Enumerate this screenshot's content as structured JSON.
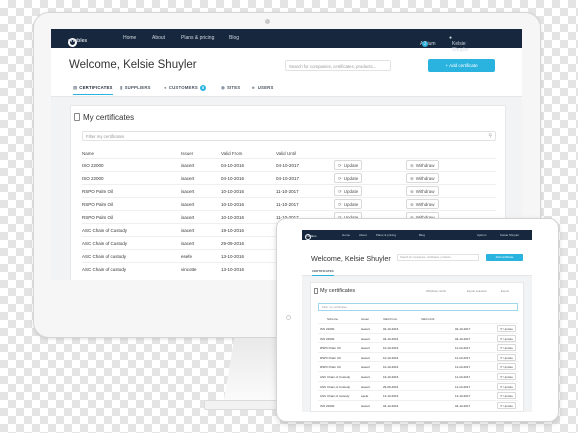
{
  "app": {
    "logo": "Certables",
    "logo_letters": "ertables",
    "nav": [
      "Home",
      "About",
      "Plans & pricing",
      "Blog"
    ],
    "notif_label": "Aptium",
    "notif_count": "3",
    "user": "Kelsie Shuyler"
  },
  "header": {
    "welcome": "Welcome, Kelsie Shuyler",
    "search_placeholder": "Search for companies, certificates, products...",
    "add_button": "Add certificate"
  },
  "tabs": [
    {
      "label": "CERTIFICATES",
      "icon": "certificate-icon"
    },
    {
      "label": "SUPPLIERS",
      "icon": "truck-icon"
    },
    {
      "label": "CUSTOMERS",
      "icon": "users-icon",
      "badge": "5"
    },
    {
      "label": "SITES",
      "icon": "pin-icon"
    },
    {
      "label": "USERS",
      "icon": "user-icon"
    }
  ],
  "certificates": {
    "title": "My certificates",
    "filter_placeholder": "Filter my certificates",
    "columns": [
      "Name",
      "Issuer",
      "Valid From",
      "Valid Until"
    ],
    "rows": [
      {
        "name": "ISO 22000",
        "issuer": "isacert",
        "from": "04-10-2016",
        "until": "04-10-2017"
      },
      {
        "name": "ISO 22000",
        "issuer": "isacert",
        "from": "04-10-2016",
        "until": "04-10-2017"
      },
      {
        "name": "RSPO Palm Oil",
        "issuer": "isacert",
        "from": "10-10-2016",
        "until": "11-10-2017"
      },
      {
        "name": "RSPO Palm Oil",
        "issuer": "isacert",
        "from": "10-10-2016",
        "until": "11-10-2017"
      },
      {
        "name": "RSPO Palm Oil",
        "issuer": "isacert",
        "from": "10-10-2016",
        "until": "11-10-2017"
      },
      {
        "name": "ASC Chain of Custody",
        "issuer": "isacert",
        "from": "19-10-2016",
        "until": ""
      },
      {
        "name": "ASC Chain of Custody",
        "issuer": "isacert",
        "from": "29-09-2016",
        "until": ""
      },
      {
        "name": "ASC Chain of custody",
        "issuer": "esefe",
        "from": "13-10-2016",
        "until": ""
      },
      {
        "name": "ASC Chain of custody",
        "issuer": "vincotte",
        "from": "13-10-2016",
        "until": ""
      }
    ],
    "update_label": "Update",
    "withdraw_label": "Withdraw"
  },
  "tablet": {
    "scheme_col": "Scheme",
    "issuer_col": "Issuer",
    "from_col": "Valid From",
    "until_col": "Valid Until",
    "actions": [
      "Withdraw certifs",
      "Export selection",
      "Export"
    ],
    "rows": [
      {
        "name": "ISO 22000",
        "issuer": "isacert",
        "from": "04-10-2016",
        "until": "04-10-2017"
      },
      {
        "name": "ISO 22000",
        "issuer": "isacert",
        "from": "04-10-2016",
        "until": "04-10-2017"
      },
      {
        "name": "RSPO Palm Oil",
        "issuer": "isacert",
        "from": "10-10-2016",
        "until": "11-10-2017"
      },
      {
        "name": "RSPO Palm Oil",
        "issuer": "isacert",
        "from": "10-10-2016",
        "until": "11-10-2017"
      },
      {
        "name": "RSPO Palm Oil",
        "issuer": "isacert",
        "from": "10-10-2016",
        "until": "11-10-2017"
      },
      {
        "name": "ASC Chain of Custody",
        "issuer": "isacert",
        "from": "19-10-2016",
        "until": "11-10-2017"
      },
      {
        "name": "ASC Chain of Custody",
        "issuer": "isacert",
        "from": "29-09-2016",
        "until": "11-10-2017"
      },
      {
        "name": "ASC Chain of custody",
        "issuer": "esefe",
        "from": "13-10-2016",
        "until": "13-10-2017"
      },
      {
        "name": "ISO 22000",
        "issuer": "isacert",
        "from": "04-10-2016",
        "until": "04-10-2017"
      }
    ]
  },
  "colors": {
    "accent": "#2bb3e0",
    "navbar": "#17273d"
  }
}
